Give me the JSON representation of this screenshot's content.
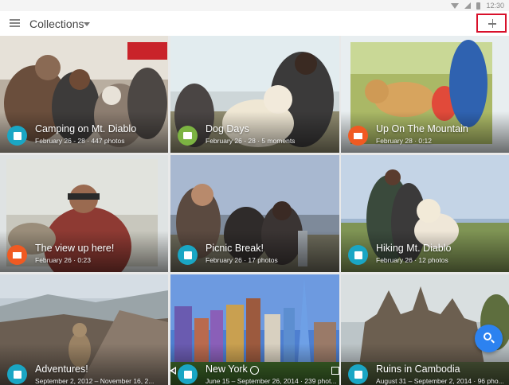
{
  "status_bar": {
    "time": "12:30"
  },
  "app_bar": {
    "title": "Collections"
  },
  "collections": [
    {
      "title": "Camping on Mt. Diablo",
      "subtitle": "February 26 - 28 · 447 photos",
      "badge_color": "#1aa6c4",
      "badge_icon": "photo-album-icon"
    },
    {
      "title": "Dog Days",
      "subtitle": "February 26 - 28 · 5 moments",
      "badge_color": "#7cb342",
      "badge_icon": "story-book-icon"
    },
    {
      "title": "Up On The Mountain",
      "subtitle": "February 28 · 0:12",
      "badge_color": "#f05a22",
      "badge_icon": "movie-icon"
    },
    {
      "title": "The view up here!",
      "subtitle": "February 26 · 0:23",
      "badge_color": "#f05a22",
      "badge_icon": "movie-icon"
    },
    {
      "title": "Picnic Break!",
      "subtitle": "February 26 · 17 photos",
      "badge_color": "#1aa6c4",
      "badge_icon": "photo-album-icon"
    },
    {
      "title": "Hiking Mt. Diablo",
      "subtitle": "February 26 · 12 photos",
      "badge_color": "#1aa6c4",
      "badge_icon": "photo-album-icon"
    },
    {
      "title": "Adventures!",
      "subtitle": "September 2, 2012 – November 16, 2...",
      "badge_color": "#1aa6c4",
      "badge_icon": "photo-album-icon"
    },
    {
      "title": "New York",
      "subtitle": "June 15 – September 26, 2014 · 239 phot...",
      "badge_color": "#1aa6c4",
      "badge_icon": "photo-album-icon"
    },
    {
      "title": "Ruins in Cambodia",
      "subtitle": "August 31 – September 2, 2014 · 96 pho...",
      "badge_color": "#1aa6c4",
      "badge_icon": "photo-album-icon"
    }
  ],
  "colors": {
    "accent": "#2c82f0",
    "highlight": "#d8102a"
  }
}
